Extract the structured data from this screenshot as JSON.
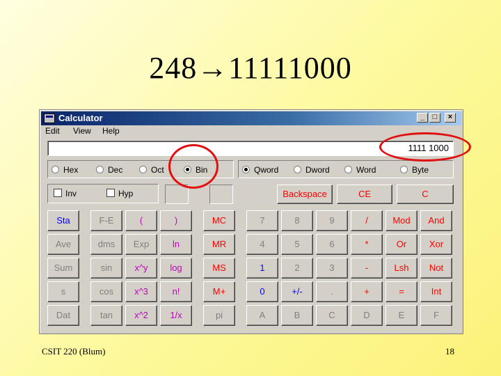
{
  "slide": {
    "title": "248→11111000",
    "footer_left": "CSIT 220 (Blum)",
    "page_number": "18"
  },
  "window": {
    "title": "Calculator",
    "controls": [
      "_",
      "□",
      "×"
    ]
  },
  "menu": [
    {
      "label": "Edit"
    },
    {
      "label": "View"
    },
    {
      "label": "Help"
    }
  ],
  "display": {
    "value": "1111 1000"
  },
  "base_options": [
    {
      "label": "Hex",
      "selected": false
    },
    {
      "label": "Dec",
      "selected": false
    },
    {
      "label": "Oct",
      "selected": false
    },
    {
      "label": "Bin",
      "selected": true
    }
  ],
  "word_options": [
    {
      "label": "Qword",
      "selected": true
    },
    {
      "label": "Dword",
      "selected": false
    },
    {
      "label": "Word",
      "selected": false
    },
    {
      "label": "Byte",
      "selected": false
    }
  ],
  "checkboxes": [
    {
      "label": "Inv",
      "checked": false
    },
    {
      "label": "Hyp",
      "checked": false
    }
  ],
  "edit_buttons": [
    "Backspace",
    "CE",
    "C"
  ],
  "keypad": [
    [
      {
        "label": "Sta",
        "c": "blue"
      },
      {
        "label": "F-E",
        "c": "gray"
      },
      {
        "label": "(",
        "c": "pur"
      },
      {
        "label": ")",
        "c": "pur"
      },
      {
        "label": "MC",
        "c": "red"
      },
      {
        "label": "7",
        "c": "gray"
      },
      {
        "label": "8",
        "c": "gray"
      },
      {
        "label": "9",
        "c": "gray"
      },
      {
        "label": "/",
        "c": "red"
      },
      {
        "label": "Mod",
        "c": "red"
      },
      {
        "label": "And",
        "c": "red"
      }
    ],
    [
      {
        "label": "Ave",
        "c": "gray"
      },
      {
        "label": "dms",
        "c": "gray"
      },
      {
        "label": "Exp",
        "c": "gray"
      },
      {
        "label": "ln",
        "c": "pur"
      },
      {
        "label": "MR",
        "c": "red"
      },
      {
        "label": "4",
        "c": "gray"
      },
      {
        "label": "5",
        "c": "gray"
      },
      {
        "label": "6",
        "c": "gray"
      },
      {
        "label": "*",
        "c": "red"
      },
      {
        "label": "Or",
        "c": "red"
      },
      {
        "label": "Xor",
        "c": "red"
      }
    ],
    [
      {
        "label": "Sum",
        "c": "gray"
      },
      {
        "label": "sin",
        "c": "gray"
      },
      {
        "label": "x^y",
        "c": "pur"
      },
      {
        "label": "log",
        "c": "pur"
      },
      {
        "label": "MS",
        "c": "red"
      },
      {
        "label": "1",
        "c": "blue"
      },
      {
        "label": "2",
        "c": "gray"
      },
      {
        "label": "3",
        "c": "gray"
      },
      {
        "label": "-",
        "c": "red"
      },
      {
        "label": "Lsh",
        "c": "red"
      },
      {
        "label": "Not",
        "c": "red"
      }
    ],
    [
      {
        "label": "s",
        "c": "gray"
      },
      {
        "label": "cos",
        "c": "gray"
      },
      {
        "label": "x^3",
        "c": "pur"
      },
      {
        "label": "n!",
        "c": "pur"
      },
      {
        "label": "M+",
        "c": "red"
      },
      {
        "label": "0",
        "c": "blue"
      },
      {
        "label": "+/-",
        "c": "blue"
      },
      {
        "label": ".",
        "c": "gray"
      },
      {
        "label": "+",
        "c": "red"
      },
      {
        "label": "=",
        "c": "red"
      },
      {
        "label": "Int",
        "c": "red"
      }
    ],
    [
      {
        "label": "Dat",
        "c": "gray"
      },
      {
        "label": "tan",
        "c": "gray"
      },
      {
        "label": "x^2",
        "c": "pur"
      },
      {
        "label": "1/x",
        "c": "pur"
      },
      {
        "label": "pi",
        "c": "gray"
      },
      {
        "label": "A",
        "c": "gray"
      },
      {
        "label": "B",
        "c": "gray"
      },
      {
        "label": "C",
        "c": "gray"
      },
      {
        "label": "D",
        "c": "gray"
      },
      {
        "label": "E",
        "c": "gray"
      },
      {
        "label": "F",
        "c": "gray"
      }
    ]
  ],
  "colors": {
    "blue": "#0000ff",
    "red": "#ff0000",
    "purple": "#c000c0",
    "gray": "#808080",
    "annotation": "#e01010"
  }
}
